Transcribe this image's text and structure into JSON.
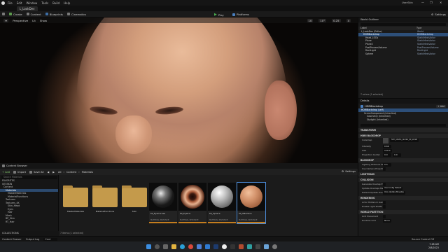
{
  "window": {
    "menu": [
      "File",
      "Edit",
      "Window",
      "Tools",
      "Build",
      "Help"
    ],
    "level_tab": "L_LookDev",
    "controls": [
      "—",
      "❐",
      "✕"
    ],
    "user_label": "UserSkin"
  },
  "toolbar": {
    "items": [
      "Create",
      "Content",
      "Blueprints",
      "Cinematics"
    ],
    "play": "Play",
    "platforms": "Platforms",
    "settings": "Settings"
  },
  "viewport": {
    "buttons": [
      "Perspective",
      "Lit",
      "Show"
    ],
    "right_values": [
      "10",
      "10°",
      "0.25",
      "4"
    ]
  },
  "outliner": {
    "tab": "World Outliner",
    "col_label": "Label",
    "col_type": "Type",
    "rows": [
      {
        "label": "L_LookDev (Editor)",
        "type": "World"
      },
      {
        "label": "HDRIBackdrop",
        "type": "HDRIBackdrop"
      },
      {
        "label": "Head_LODs",
        "type": "StaticMeshActor"
      },
      {
        "label": "Plane",
        "type": "StaticMeshActor"
      },
      {
        "label": "Plane2",
        "type": "StaticMeshActor"
      },
      {
        "label": "PostProcessVolume",
        "type": "PostProcessVolume"
      },
      {
        "label": "RectLight",
        "type": "RectLight"
      },
      {
        "label": "Sphere",
        "type": "StaticMeshActor"
      }
    ],
    "status": "7 actors (1 selected)"
  },
  "details": {
    "tab": "Details",
    "actor": "HDRIBackdrop",
    "instance": "HDRIBackdrop (self)",
    "components": [
      "SceneComponent (Inherited)",
      "Geometry (Inherited)",
      "Skylight (Inherited)"
    ],
    "sections": {
      "transform": "TRANSFORM",
      "hdri": "HDRI BACKDROP",
      "backdrop": "BACKDROP",
      "lightmass": "LIGHTMASS",
      "collision": "COLLISION",
      "rendering": "RENDERING",
      "world_partition": "WORLD PARTITION"
    },
    "props": [
      {
        "label": "Cubemap",
        "value": "hdri_studio_render_4k_small"
      },
      {
        "label": "Intensity",
        "value": "0.66"
      },
      {
        "label": "Size",
        "value": "150.0"
      },
      {
        "label": "Projection Center",
        "value": "0.0"
      },
      {
        "label": "Lighting Distance Factor",
        "value": "0.5"
      },
      {
        "label": "Use Camera Projection",
        "value": ""
      },
      {
        "label": "Generate Overlap Events",
        "value": ""
      },
      {
        "label": "Update Overlaps Method",
        "value": "Use Config Default"
      },
      {
        "label": "Default Update Overlap",
        "value": "Only Update Movable"
      },
      {
        "label": "Actor Hidden In Game",
        "value": ""
      },
      {
        "label": "Enable Light Shafts",
        "value": ""
      },
      {
        "label": "Grid Placement",
        "value": ""
      },
      {
        "label": "Runtime Grid",
        "value": "None"
      }
    ],
    "add_btn": "+ Add"
  },
  "content_browser": {
    "tab": "Content Browser",
    "add": "+ Add",
    "import": "Import",
    "save_all": "Save All",
    "path": [
      "All",
      "Content",
      "Materials"
    ],
    "settings": "Settings",
    "search_placeholder": "Search Materials",
    "favorites": "FAVORITES",
    "tree_root": "UE5SKIN",
    "tree": [
      "Content",
      "Materials",
      "MasterMaterials",
      "MaterialFunctions",
      "Textures",
      "Textures_4K",
      "Skin_Head",
      "Eyes",
      "Hair",
      "Mesh",
      "BP_Skin",
      "RT_Hair"
    ],
    "collections": "COLLECTIONS",
    "folders": [
      "MasterMaterials",
      "MaterialFunctions",
      "Skin"
    ],
    "assets": [
      {
        "name": "MI_EyeCornea",
        "type": "MATERIAL INSTANCE"
      },
      {
        "name": "MI_EyeIris",
        "type": "MATERIAL INSTANCE"
      },
      {
        "name": "MI_Sphere",
        "type": "MATERIAL INSTANCE"
      },
      {
        "name": "MI_UBerSkin",
        "type": "MATERIAL INSTANCE"
      }
    ],
    "status": "7 items (1 selected)"
  },
  "statusbar": {
    "items": [
      "Content Drawer",
      "Output Log",
      "Cmd"
    ],
    "right": "Source Control Off"
  },
  "taskbar": {
    "time": "7:48 AM",
    "date": "2/8/2023"
  },
  "colors": {
    "accent": "#2d4f79",
    "play_green": "#4caf50",
    "asset_underline": "#c47d1e"
  }
}
